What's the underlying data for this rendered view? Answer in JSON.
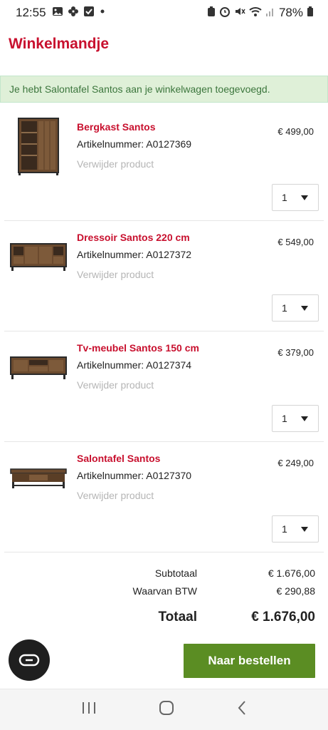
{
  "status_bar": {
    "time": "12:55",
    "battery_pct": "78%",
    "icons": [
      "gallery-icon",
      "flower-icon",
      "checkbox-icon",
      "dot-icon",
      "battery-saver-icon",
      "alarm-icon",
      "mute-icon",
      "wifi-icon",
      "signal-icon",
      "battery-icon"
    ]
  },
  "page": {
    "title": "Winkelmandje"
  },
  "notice": {
    "text": "Je hebt Salontafel Santos aan je winkelwagen toegevoegd."
  },
  "items": [
    {
      "name": "Bergkast Santos",
      "sku": "Artikelnummer: A0127369",
      "remove": "Verwijder product",
      "price": "€ 499,00",
      "qty": "1",
      "image": "cabinet"
    },
    {
      "name": "Dressoir Santos 220 cm",
      "sku": "Artikelnummer: A0127372",
      "remove": "Verwijder product",
      "price": "€ 549,00",
      "qty": "1",
      "image": "sideboard"
    },
    {
      "name": "Tv-meubel Santos 150 cm",
      "sku": "Artikelnummer: A0127374",
      "remove": "Verwijder product",
      "price": "€ 379,00",
      "qty": "1",
      "image": "tv-stand"
    },
    {
      "name": "Salontafel Santos",
      "sku": "Artikelnummer: A0127370",
      "remove": "Verwijder product",
      "price": "€ 249,00",
      "qty": "1",
      "image": "coffee-table"
    }
  ],
  "totals": {
    "subtotal_label": "Subtotaal",
    "subtotal_value": "€ 1.676,00",
    "vat_label": "Waarvan BTW",
    "vat_value": "€ 290,88",
    "total_label": "Totaal",
    "total_value": "€ 1.676,00"
  },
  "actions": {
    "order_label": "Naar bestellen"
  },
  "colors": {
    "brand_red": "#c8102e",
    "order_green": "#5b8d23",
    "notice_bg": "#dff0d8",
    "notice_text": "#3c763d"
  }
}
